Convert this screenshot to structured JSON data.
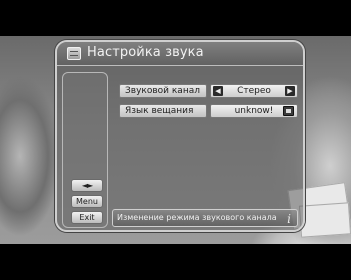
{
  "window": {
    "title": "Настройка звука"
  },
  "settings": [
    {
      "label": "Звуковой канал",
      "value": "Стерео",
      "control": "arrows"
    },
    {
      "label": "Язык вещания",
      "value": "unknow!",
      "control": "dropdown"
    }
  ],
  "side_keys": {
    "arrows": "◄►",
    "menu": "Menu",
    "exit": "Exit"
  },
  "hint": {
    "text": "Изменение режима звукового канала",
    "icon": "info-icon"
  },
  "icons": {
    "title": "menu-list-icon",
    "left": "arrow-left-icon",
    "right": "arrow-right-icon",
    "dropdown": "dropdown-icon"
  }
}
